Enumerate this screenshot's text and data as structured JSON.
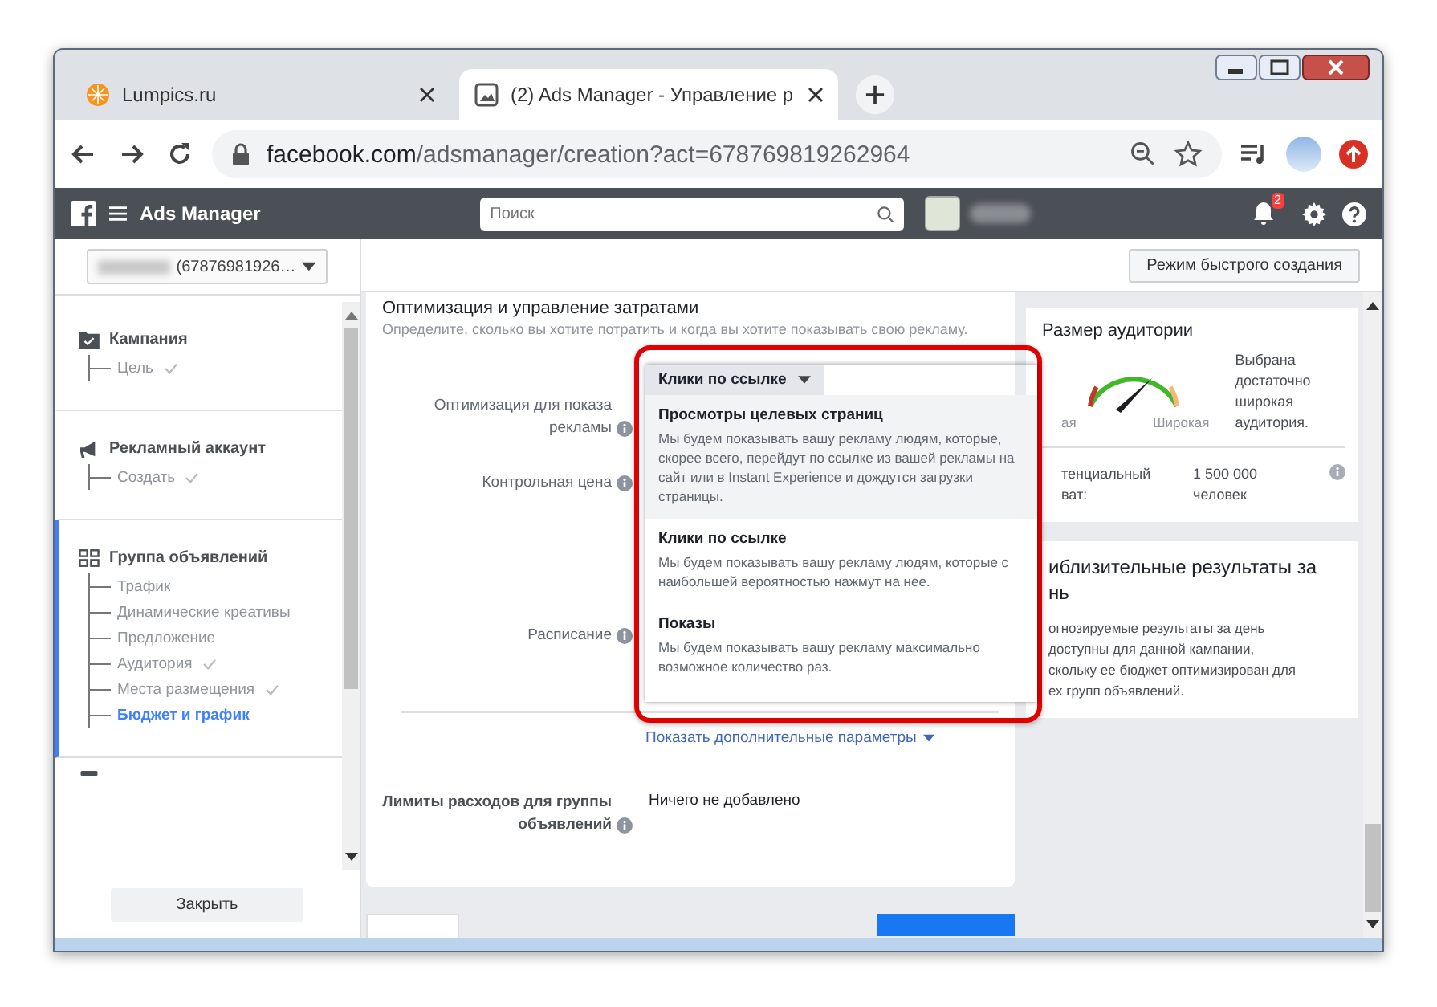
{
  "browser": {
    "tabs": [
      {
        "title": "Lumpics.ru",
        "selected": false,
        "kind": "orange"
      },
      {
        "title": "(2) Ads Manager - Управление р",
        "selected": true,
        "kind": "page"
      }
    ],
    "url_host": "facebook.com",
    "url_path": "/adsmanager/creation?act=678769819262964"
  },
  "topbar": {
    "app_name": "Ads Manager",
    "search_placeholder": "Поиск",
    "notifications": "2"
  },
  "sidebar": {
    "account": "(67876981926…",
    "sections": [
      {
        "title": "Кампания",
        "kind": "campaign",
        "active": false,
        "items": [
          {
            "label": "Цель",
            "done": true,
            "selected": false
          }
        ]
      },
      {
        "title": "Рекламный аккаунт",
        "kind": "account",
        "active": false,
        "items": [
          {
            "label": "Создать",
            "done": true,
            "selected": false
          }
        ]
      },
      {
        "title": "Группа объявлений",
        "kind": "adset",
        "active": true,
        "items": [
          {
            "label": "Трафик",
            "done": false,
            "selected": false
          },
          {
            "label": "Динамические креативы",
            "done": false,
            "selected": false
          },
          {
            "label": "Предложение",
            "done": false,
            "selected": false
          },
          {
            "label": "Аудитория",
            "done": true,
            "selected": false
          },
          {
            "label": "Места размещения",
            "done": true,
            "selected": false
          },
          {
            "label": "Бюджет и график",
            "done": false,
            "selected": true
          }
        ]
      }
    ],
    "close_button": "Закрыть"
  },
  "quick_mode_button": "Режим быстрого создания",
  "form": {
    "heading": "Оптимизация и управление затратами",
    "subheading": "Определите, сколько вы хотите потратить и когда вы хотите показывать свою рекламу.",
    "rows": [
      {
        "label": "Оптимизация для показа рекламы",
        "info": true
      },
      {
        "label": "Контрольная цена",
        "info": true
      },
      {
        "label": "Расписание",
        "info": true
      }
    ],
    "more_link": "Показать дополнительные параметры",
    "limits_label": "Лимиты расходов для группы объявлений",
    "limits_value": "Ничего не добавлено"
  },
  "dropdown": {
    "value": "Клики по ссылке",
    "options": [
      {
        "title": "Просмотры целевых страниц",
        "description": "Мы будем показывать вашу рекламу людям, которые, скорее всего, перейдут по ссылке из вашей рекламы на сайт или в Instant Experience и дождутся загрузки страницы.",
        "highlighted": true
      },
      {
        "title": "Клики по ссылке",
        "description": "Мы будем показывать вашу рекламу людям, которые с наибольшей вероятностью нажмут на нее.",
        "highlighted": false
      },
      {
        "title": "Показы",
        "description": "Мы будем показывать вашу рекламу максимально возможное количество раз.",
        "highlighted": false
      }
    ]
  },
  "audience": {
    "title": "Размер аудитории",
    "gauge_low": "ая",
    "gauge_high": "Широкая",
    "verdict": "Выбрана достаточно широкая аудитория.",
    "reach_label": [
      "тенциальный",
      "ват:"
    ],
    "reach_value": "1 500 000 человек"
  },
  "estimate": {
    "title": [
      "иблизительные результаты за",
      "нь"
    ],
    "body": [
      "огнозируемые результаты за день",
      "доступны для данной кампании,",
      "скольку ее бюджет оптимизирован для",
      "ех групп объявлений."
    ]
  }
}
